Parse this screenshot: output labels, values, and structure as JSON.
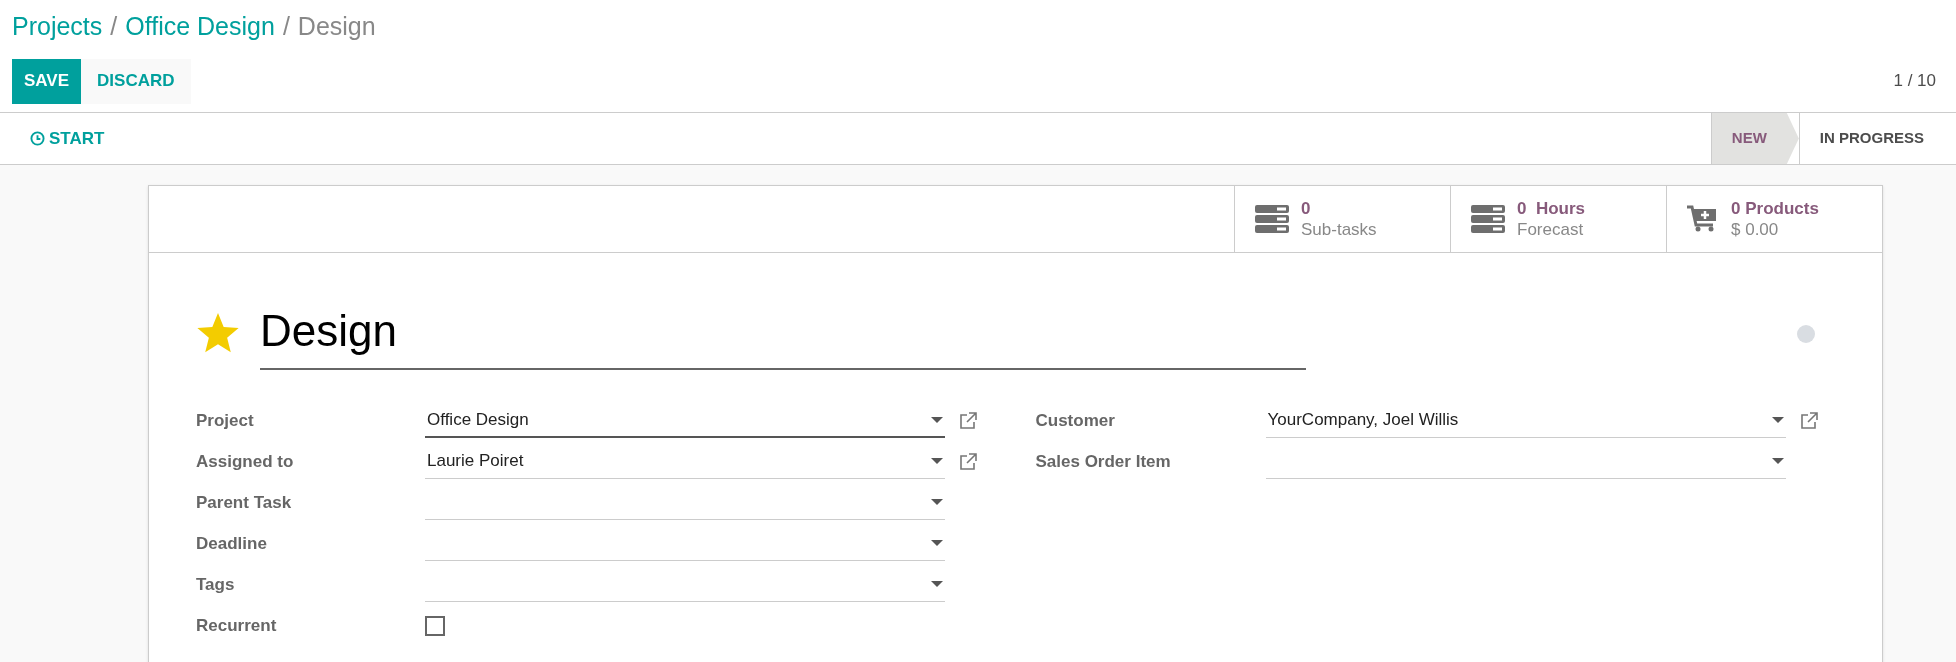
{
  "breadcrumb": [
    {
      "kind": "link",
      "label": "Projects"
    },
    {
      "kind": "separator",
      "label": "/"
    },
    {
      "kind": "link",
      "label": "Office Design"
    },
    {
      "kind": "separator",
      "label": "/"
    },
    {
      "kind": "current",
      "label": "Design"
    }
  ],
  "buttons": {
    "save": "SAVE",
    "discard": "DISCARD"
  },
  "pager": "1 / 10",
  "actions": [
    {
      "label": "START"
    }
  ],
  "stages": [
    {
      "label": "NEW",
      "selected": true
    },
    {
      "label": "IN PROGRESS",
      "selected": false
    }
  ],
  "stat_buttons": [
    {
      "kind": "list",
      "value": "0",
      "label": "Sub-tasks"
    },
    {
      "kind": "list",
      "value": "0  Hours",
      "label": "Forecast"
    },
    {
      "kind": "cart",
      "value": "0 Products",
      "label": "$ 0.00"
    }
  ],
  "task": {
    "starred": true,
    "title": "Design"
  },
  "left_fields": [
    {
      "label": "Project",
      "kind": "select",
      "value": "Office Design",
      "focused": true,
      "external_link": true
    },
    {
      "label": "Assigned to",
      "kind": "select",
      "value": "Laurie Poiret",
      "focused": false,
      "external_link": true
    },
    {
      "label": "Parent Task",
      "kind": "select",
      "focused": false,
      "external_link": false
    },
    {
      "label": "Deadline",
      "kind": "select",
      "focused": false,
      "external_link": false
    },
    {
      "label": "Tags",
      "kind": "select",
      "focused": false,
      "external_link": false
    },
    {
      "label": "Recurrent",
      "kind": "checkbox",
      "checked": false
    }
  ],
  "right_fields": [
    {
      "label": "Customer",
      "kind": "select",
      "value": "YourCompany, Joel Willis",
      "focused": false,
      "external_link": true
    },
    {
      "label": "Sales Order Item",
      "kind": "select",
      "focused": false,
      "external_link": false
    }
  ]
}
